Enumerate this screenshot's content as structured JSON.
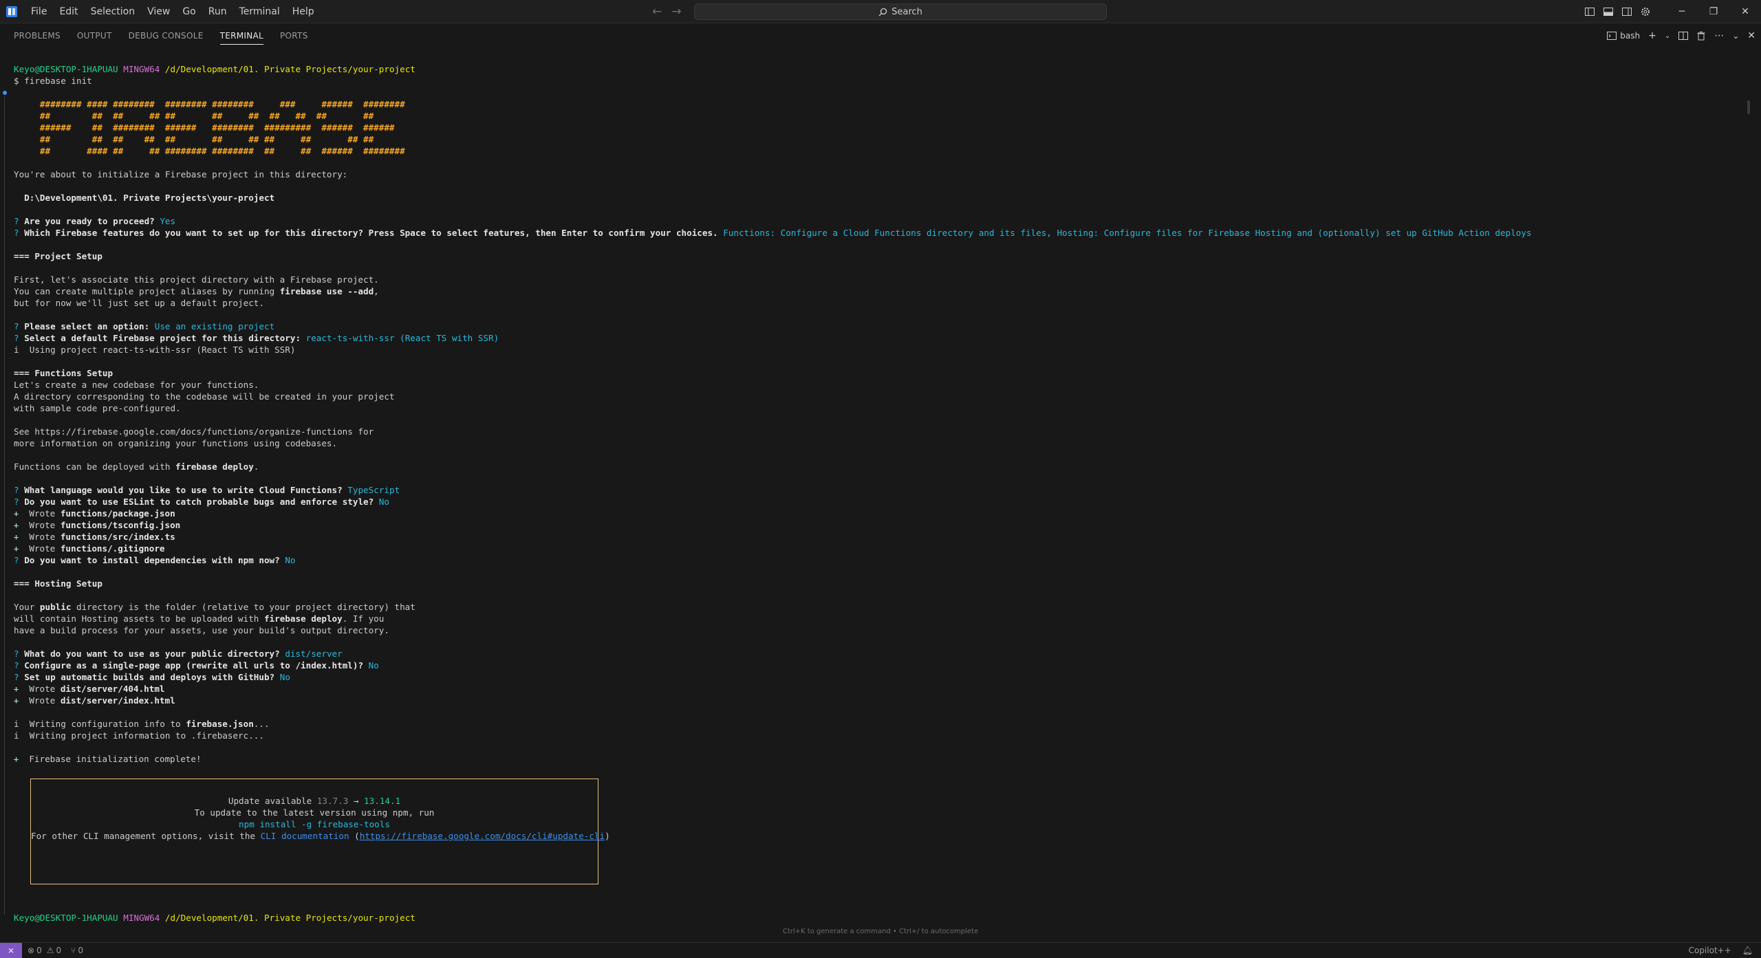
{
  "window": {
    "menus": [
      "File",
      "Edit",
      "Selection",
      "View",
      "Go",
      "Run",
      "Terminal",
      "Help"
    ],
    "search_label": "Search",
    "accent": "#3794ff"
  },
  "panel": {
    "tabs": [
      "PROBLEMS",
      "OUTPUT",
      "DEBUG CONSOLE",
      "TERMINAL",
      "PORTS"
    ],
    "active_tab": "TERMINAL",
    "terminal_name": "bash"
  },
  "terminal": {
    "prompt_user": "Keyo@DESKTOP-1HAPUAU",
    "prompt_env": "MINGW64",
    "prompt_path": "/d/Development/01. Private Projects/your-project",
    "command": "$ firebase init",
    "banner": [
      "######## #### ########  ######## ########     ###     ######  ########",
      "##        ##  ##     ## ##       ##     ##  ##   ##  ##       ##",
      "######    ##  ########  ######   ########  #########  ######  ######",
      "##        ##  ##    ##  ##       ##     ## ##     ##       ## ##",
      "##       #### ##     ## ######## ########  ##     ##  ######  ########"
    ],
    "about_to_init": "You're about to initialize a Firebase project in this directory:",
    "project_dir": "  D:\\Development\\01. Private Projects\\your-project",
    "q_ready": "Are you ready to proceed?",
    "a_ready": "Yes",
    "q_features": "Which Firebase features do you want to set up for this directory? Press Space to select features, then Enter to confirm your choices.",
    "a_features": "Functions: Configure a Cloud Functions directory and its files, Hosting: Configure files for Firebase Hosting and (optionally) set up GitHub Action deploys",
    "project_setup_header": "=== Project Setup",
    "project_setup_1": "First, let's associate this project directory with a Firebase project.",
    "project_setup_2a": "You can create multiple project aliases by running ",
    "project_setup_2b": "firebase use --add",
    "project_setup_2c": ",",
    "project_setup_3": "but for now we'll just set up a default project.",
    "q_option": "Please select an option:",
    "a_option": "Use an existing project",
    "q_default_project": "Select a default Firebase project for this directory:",
    "a_default_project": "react-ts-with-ssr (React TS with SSR)",
    "using_project": "i  Using project react-ts-with-ssr (React TS with SSR)",
    "functions_header": "=== Functions Setup",
    "functions_1": "Let's create a new codebase for your functions.",
    "functions_2": "A directory corresponding to the codebase will be created in your project",
    "functions_3": "with sample code pre-configured.",
    "functions_4": "See https://firebase.google.com/docs/functions/organize-functions for",
    "functions_5": "more information on organizing your functions using codebases.",
    "functions_6a": "Functions can be deployed with ",
    "functions_6b": "firebase deploy",
    "functions_6c": ".",
    "q_language": "What language would you like to use to write Cloud Functions?",
    "a_language": "TypeScript",
    "q_eslint": "Do you want to use ESLint to catch probable bugs and enforce style?",
    "a_eslint": "No",
    "wrote_prefix": "+  Wrote ",
    "wrote_functions": [
      "functions/package.json",
      "functions/tsconfig.json",
      "functions/src/index.ts",
      "functions/.gitignore"
    ],
    "q_install": "Do you want to install dependencies with npm now?",
    "a_install": "No",
    "hosting_header": "=== Hosting Setup",
    "hosting_1a": "Your ",
    "hosting_1b": "public",
    "hosting_1c": " directory is the folder (relative to your project directory) that",
    "hosting_2a": "will contain Hosting assets to be uploaded with ",
    "hosting_2b": "firebase deploy",
    "hosting_2c": ". If you",
    "hosting_3": "have a build process for your assets, use your build's output directory.",
    "q_public": "What do you want to use as your public directory?",
    "a_public": "dist/server",
    "q_spa": "Configure as a single-page app (rewrite all urls to /index.html)?",
    "a_spa": "No",
    "q_github": "Set up automatic builds and deploys with GitHub?",
    "a_github": "No",
    "wrote_hosting": [
      "dist/server/404.html",
      "dist/server/index.html"
    ],
    "writing_config_a": "i  Writing configuration info to ",
    "writing_config_b": "firebase.json",
    "writing_config_c": "...",
    "writing_project": "i  Writing project information to .firebaserc...",
    "init_complete": "+  Firebase initialization complete!",
    "update": {
      "label": "Update available ",
      "from_version": "13.7.3",
      "arrow": " → ",
      "to_version": "13.14.1",
      "line2": "To update to the latest version using npm, run",
      "line3": "npm install -g firebase-tools",
      "line4a": "For other CLI management options, visit the ",
      "line4b": "CLI documentation",
      "line4c": " (",
      "line4d": "https://firebase.google.com/docs/cli#update-cli",
      "line4e": ")"
    },
    "input_hint": "Ctrl+K to generate a command • Ctrl+/ to autocomplete"
  },
  "status": {
    "errors": "0",
    "warnings": "0",
    "ports": "0",
    "copilot": "Copilot++"
  }
}
